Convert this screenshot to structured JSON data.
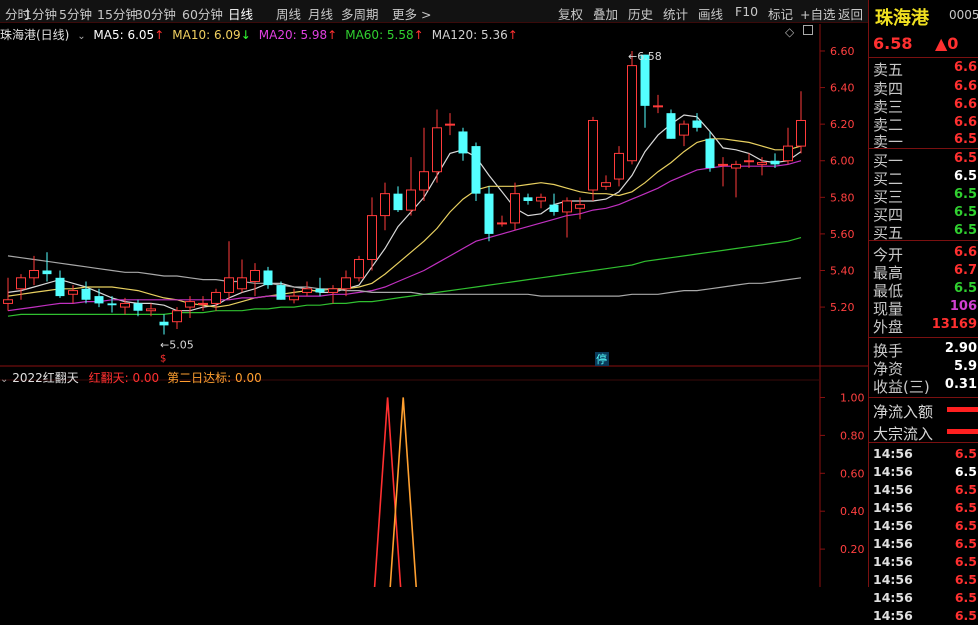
{
  "toolbar": {
    "left_items": [
      "分时",
      "1分钟",
      "5分钟",
      "15分钟",
      "30分钟",
      "60分钟",
      "日线",
      "周线",
      "月线",
      "多周期",
      "更多 >"
    ],
    "active": "日线",
    "right_items": [
      "复权",
      "叠加",
      "历史",
      "统计",
      "画线",
      "F10",
      "标记",
      "+自选",
      "返回"
    ]
  },
  "legend": {
    "title": "珠海港(日线)",
    "ma": [
      {
        "label": "MA5: 6.05",
        "arrow": "↑",
        "color": "#ffffff",
        "arrow_color": "#ff3030"
      },
      {
        "label": "MA10: 6.09",
        "arrow": "↓",
        "color": "#f0d060",
        "arrow_color": "#30ff30"
      },
      {
        "label": "MA20: 5.98",
        "arrow": "↑",
        "color": "#e040e0",
        "arrow_color": "#ff3030"
      },
      {
        "label": "MA60: 5.58",
        "arrow": "↑",
        "color": "#30d030",
        "arrow_color": "#ff3030"
      },
      {
        "label": "MA120: 5.36",
        "arrow": "↑",
        "color": "#d0d0d0",
        "arrow_color": "#ff3030"
      }
    ]
  },
  "indicator": {
    "name": "2022红翻天",
    "items": [
      {
        "label": "红翻天: 0.00",
        "color": "#ff3030"
      },
      {
        "label": "第二日达标: 0.00",
        "color": "#ffa030"
      }
    ],
    "scale": [
      "1.00",
      "0.80",
      "0.60",
      "0.40",
      "0.20"
    ]
  },
  "price_scale": [
    "6.60",
    "6.40",
    "6.20",
    "6.00",
    "5.80",
    "5.60",
    "5.40",
    "5.20"
  ],
  "annotations": {
    "high": "6.58",
    "low": "5.05",
    "stop_tag": "停"
  },
  "chart_data": {
    "type": "candlestick",
    "ylim": [
      5.02,
      6.66
    ],
    "candles": [
      [
        5.22,
        5.36,
        5.18,
        5.24
      ],
      [
        5.3,
        5.38,
        5.24,
        5.36
      ],
      [
        5.36,
        5.48,
        5.32,
        5.4
      ],
      [
        5.4,
        5.5,
        5.34,
        5.38
      ],
      [
        5.36,
        5.4,
        5.25,
        5.26
      ],
      [
        5.27,
        5.32,
        5.22,
        5.29
      ],
      [
        5.3,
        5.34,
        5.22,
        5.24
      ],
      [
        5.26,
        5.3,
        5.2,
        5.22
      ],
      [
        5.22,
        5.26,
        5.17,
        5.21
      ],
      [
        5.2,
        5.25,
        5.16,
        5.22
      ],
      [
        5.22,
        5.24,
        5.15,
        5.18
      ],
      [
        5.18,
        5.22,
        5.15,
        5.19
      ],
      [
        5.12,
        5.16,
        5.05,
        5.1
      ],
      [
        5.12,
        5.2,
        5.08,
        5.18
      ],
      [
        5.2,
        5.26,
        5.14,
        5.23
      ],
      [
        5.22,
        5.26,
        5.18,
        5.22
      ],
      [
        5.22,
        5.3,
        5.18,
        5.28
      ],
      [
        5.28,
        5.56,
        5.24,
        5.36
      ],
      [
        5.3,
        5.46,
        5.28,
        5.36
      ],
      [
        5.34,
        5.44,
        5.26,
        5.4
      ],
      [
        5.4,
        5.42,
        5.3,
        5.32
      ],
      [
        5.32,
        5.34,
        5.24,
        5.24
      ],
      [
        5.24,
        5.3,
        5.22,
        5.26
      ],
      [
        5.28,
        5.34,
        5.26,
        5.3
      ],
      [
        5.3,
        5.36,
        5.26,
        5.28
      ],
      [
        5.28,
        5.32,
        5.22,
        5.3
      ],
      [
        5.3,
        5.4,
        5.26,
        5.36
      ],
      [
        5.36,
        5.48,
        5.34,
        5.46
      ],
      [
        5.46,
        5.8,
        5.4,
        5.7
      ],
      [
        5.7,
        5.88,
        5.62,
        5.82
      ],
      [
        5.82,
        5.86,
        5.72,
        5.73
      ],
      [
        5.73,
        6.02,
        5.7,
        5.84
      ],
      [
        5.84,
        6.18,
        5.78,
        5.94
      ],
      [
        5.94,
        6.28,
        5.88,
        6.18
      ],
      [
        6.2,
        6.26,
        6.14,
        6.2
      ],
      [
        6.16,
        6.18,
        6.0,
        6.04
      ],
      [
        6.08,
        6.1,
        5.78,
        5.82
      ],
      [
        5.82,
        5.86,
        5.56,
        5.6
      ],
      [
        5.66,
        5.7,
        5.64,
        5.66
      ],
      [
        5.66,
        5.88,
        5.62,
        5.82
      ],
      [
        5.8,
        5.82,
        5.76,
        5.78
      ],
      [
        5.78,
        5.82,
        5.74,
        5.8
      ],
      [
        5.76,
        5.82,
        5.7,
        5.72
      ],
      [
        5.72,
        5.8,
        5.58,
        5.78
      ],
      [
        5.74,
        5.8,
        5.68,
        5.76
      ],
      [
        5.84,
        6.24,
        5.78,
        6.22
      ],
      [
        5.86,
        5.92,
        5.84,
        5.88
      ],
      [
        5.9,
        6.08,
        5.86,
        6.04
      ],
      [
        6.0,
        6.6,
        5.98,
        6.52
      ],
      [
        6.58,
        6.58,
        6.18,
        6.3
      ],
      [
        6.3,
        6.36,
        6.26,
        6.3
      ],
      [
        6.26,
        6.28,
        6.12,
        6.12
      ],
      [
        6.14,
        6.22,
        6.08,
        6.2
      ],
      [
        6.22,
        6.26,
        6.16,
        6.18
      ],
      [
        6.12,
        6.16,
        5.94,
        5.96
      ],
      [
        5.98,
        6.02,
        5.86,
        5.98
      ],
      [
        5.96,
        6.0,
        5.8,
        5.98
      ],
      [
        6.0,
        6.04,
        5.96,
        6.0
      ],
      [
        5.98,
        6.02,
        5.92,
        5.99
      ],
      [
        6.0,
        6.04,
        5.96,
        5.98
      ],
      [
        6.0,
        6.18,
        5.98,
        6.08
      ],
      [
        6.08,
        6.38,
        6.04,
        6.22
      ]
    ],
    "ma_lines": [
      {
        "name": "MA5",
        "color": "#d8d8d8",
        "values": [
          5.28,
          5.29,
          5.31,
          5.33,
          5.35,
          5.33,
          5.31,
          5.28,
          5.25,
          5.23,
          5.22,
          5.22,
          5.21,
          5.18,
          5.18,
          5.2,
          5.21,
          5.25,
          5.28,
          5.3,
          5.33,
          5.33,
          5.31,
          5.3,
          5.28,
          5.28,
          5.3,
          5.32,
          5.42,
          5.52,
          5.64,
          5.72,
          5.8,
          5.92,
          6.04,
          6.06,
          6.02,
          5.92,
          5.83,
          5.74,
          5.7,
          5.71,
          5.76,
          5.78,
          5.78,
          5.78,
          5.79,
          5.83,
          5.92,
          6.05,
          6.14,
          6.2,
          6.25,
          6.24,
          6.16,
          6.07,
          6.06,
          6.04,
          6.0,
          5.99,
          6.0,
          6.05
        ]
      },
      {
        "name": "MA10",
        "color": "#e8d060",
        "values": [
          5.26,
          5.27,
          5.28,
          5.29,
          5.3,
          5.3,
          5.31,
          5.31,
          5.31,
          5.3,
          5.29,
          5.27,
          5.25,
          5.24,
          5.22,
          5.21,
          5.2,
          5.21,
          5.23,
          5.25,
          5.26,
          5.27,
          5.28,
          5.29,
          5.29,
          5.3,
          5.3,
          5.31,
          5.33,
          5.38,
          5.44,
          5.5,
          5.56,
          5.63,
          5.72,
          5.79,
          5.84,
          5.86,
          5.86,
          5.86,
          5.87,
          5.88,
          5.87,
          5.85,
          5.83,
          5.82,
          5.82,
          5.81,
          5.83,
          5.88,
          5.94,
          5.99,
          6.05,
          6.1,
          6.12,
          6.12,
          6.11,
          6.1,
          6.08,
          6.06,
          6.06,
          6.08
        ]
      },
      {
        "name": "MA20",
        "color": "#c030c0",
        "values": [
          5.18,
          5.19,
          5.2,
          5.21,
          5.22,
          5.22,
          5.23,
          5.23,
          5.24,
          5.24,
          5.24,
          5.24,
          5.24,
          5.24,
          5.24,
          5.24,
          5.24,
          5.24,
          5.25,
          5.25,
          5.26,
          5.26,
          5.26,
          5.26,
          5.26,
          5.27,
          5.27,
          5.28,
          5.29,
          5.31,
          5.34,
          5.37,
          5.4,
          5.44,
          5.48,
          5.52,
          5.56,
          5.58,
          5.6,
          5.62,
          5.64,
          5.66,
          5.68,
          5.7,
          5.71,
          5.73,
          5.74,
          5.76,
          5.79,
          5.82,
          5.85,
          5.89,
          5.92,
          5.95,
          5.96,
          5.97,
          5.97,
          5.97,
          5.97,
          5.97,
          5.98,
          6.0
        ]
      },
      {
        "name": "MA60",
        "color": "#30c030",
        "values": [
          5.15,
          5.16,
          5.16,
          5.16,
          5.16,
          5.16,
          5.16,
          5.16,
          5.16,
          5.16,
          5.16,
          5.16,
          5.16,
          5.17,
          5.17,
          5.17,
          5.18,
          5.18,
          5.18,
          5.19,
          5.19,
          5.2,
          5.2,
          5.21,
          5.21,
          5.22,
          5.22,
          5.23,
          5.23,
          5.24,
          5.25,
          5.26,
          5.27,
          5.28,
          5.29,
          5.3,
          5.31,
          5.32,
          5.33,
          5.34,
          5.35,
          5.36,
          5.37,
          5.38,
          5.39,
          5.4,
          5.41,
          5.42,
          5.43,
          5.45,
          5.46,
          5.47,
          5.48,
          5.49,
          5.5,
          5.51,
          5.52,
          5.53,
          5.54,
          5.55,
          5.56,
          5.58
        ]
      },
      {
        "name": "MA120",
        "color": "#a8a8a8",
        "values": [
          5.48,
          5.47,
          5.46,
          5.45,
          5.44,
          5.43,
          5.42,
          5.41,
          5.4,
          5.39,
          5.39,
          5.38,
          5.37,
          5.37,
          5.36,
          5.35,
          5.35,
          5.34,
          5.34,
          5.33,
          5.33,
          5.32,
          5.31,
          5.31,
          5.3,
          5.3,
          5.29,
          5.29,
          5.28,
          5.28,
          5.28,
          5.28,
          5.27,
          5.27,
          5.27,
          5.27,
          5.27,
          5.27,
          5.27,
          5.27,
          5.27,
          5.26,
          5.26,
          5.26,
          5.26,
          5.26,
          5.26,
          5.26,
          5.27,
          5.27,
          5.27,
          5.28,
          5.29,
          5.29,
          5.3,
          5.31,
          5.32,
          5.33,
          5.33,
          5.34,
          5.35,
          5.36
        ]
      }
    ],
    "indicator_series": [
      {
        "name": "红翻天",
        "color": "#ff3030",
        "values": [
          0,
          0,
          0,
          0,
          0,
          0,
          0,
          0,
          0,
          0,
          0,
          0,
          0,
          0,
          0,
          0,
          0,
          0,
          0,
          0,
          0,
          0,
          0,
          0,
          0,
          0,
          0,
          0,
          0,
          0,
          0,
          0,
          0,
          0,
          0,
          0,
          0,
          0,
          0,
          0,
          0,
          0,
          0,
          0,
          0,
          0,
          0,
          0,
          0,
          0,
          0,
          0,
          0,
          0,
          0,
          0,
          0,
          0,
          0,
          0,
          0,
          0
        ]
      },
      {
        "name": "第二日达标",
        "color": "#ffa030",
        "values": [
          0,
          0,
          0,
          0,
          0,
          0,
          0,
          0,
          0,
          0,
          0,
          0,
          0,
          0,
          0,
          0,
          0,
          0,
          0,
          0,
          0,
          0,
          0,
          0,
          0,
          0,
          0,
          0,
          0,
          0,
          0,
          0,
          0,
          0,
          0,
          0,
          0,
          0,
          0,
          0,
          0,
          0,
          0,
          0,
          0,
          0,
          0,
          0,
          0,
          0,
          0,
          0,
          0,
          0,
          0,
          0,
          0,
          0,
          0,
          0,
          0,
          0
        ]
      }
    ],
    "indicator_peaks": [
      {
        "name": "红翻天",
        "index": 29.2,
        "value": 1.0,
        "color": "#ff3030"
      },
      {
        "name": "第二日达标",
        "index": 30.4,
        "value": 1.0,
        "color": "#ffa030"
      }
    ],
    "ind_ylim": [
      0,
      1.05
    ]
  },
  "right_panel": {
    "stock_name": "珠海港",
    "code": "0005",
    "price": "6.58",
    "change_arrow": "▲0",
    "quote_rows": [
      {
        "k": "卖五",
        "v": "6.6",
        "c": "#ff3030"
      },
      {
        "k": "卖四",
        "v": "6.6",
        "c": "#ff3030"
      },
      {
        "k": "卖三",
        "v": "6.6",
        "c": "#ff3030"
      },
      {
        "k": "卖二",
        "v": "6.6",
        "c": "#ff3030"
      },
      {
        "k": "卖一",
        "v": "6.5",
        "c": "#ff3030"
      },
      {
        "k": "买一",
        "v": "6.5",
        "c": "#ff3030"
      },
      {
        "k": "买二",
        "v": "6.5",
        "c": "#ffffff"
      },
      {
        "k": "买三",
        "v": "6.5",
        "c": "#30d030"
      },
      {
        "k": "买四",
        "v": "6.5",
        "c": "#30d030"
      },
      {
        "k": "买五",
        "v": "6.5",
        "c": "#30d030"
      },
      {
        "k": "今开",
        "v": "6.6",
        "c": "#ff3030"
      },
      {
        "k": "最高",
        "v": "6.7",
        "c": "#ff3030"
      },
      {
        "k": "最低",
        "v": "6.5",
        "c": "#30d030"
      },
      {
        "k": "现量",
        "v": "106",
        "c": "#d040d0"
      },
      {
        "k": "外盘",
        "v": "13169",
        "c": "#ff3030"
      },
      {
        "k": "换手",
        "v": "2.90",
        "c": "#ffffff"
      },
      {
        "k": "净资",
        "v": "5.9",
        "c": "#ffffff"
      },
      {
        "k": "收益(三)",
        "v": "0.31",
        "c": "#ffffff"
      }
    ],
    "flow": [
      {
        "label": "净流入额",
        "bar_color": "#ff2020"
      },
      {
        "label": "大宗流入",
        "bar_color": "#ff2020"
      }
    ],
    "ticks": [
      {
        "t": "14:56",
        "p": "6.5",
        "c": "#ff3030"
      },
      {
        "t": "14:56",
        "p": "6.5",
        "c": "#ffffff"
      },
      {
        "t": "14:56",
        "p": "6.5",
        "c": "#ff3030"
      },
      {
        "t": "14:56",
        "p": "6.5",
        "c": "#ff3030"
      },
      {
        "t": "14:56",
        "p": "6.5",
        "c": "#ff3030"
      },
      {
        "t": "14:56",
        "p": "6.5",
        "c": "#ff3030"
      },
      {
        "t": "14:56",
        "p": "6.5",
        "c": "#ff3030"
      },
      {
        "t": "14:56",
        "p": "6.5",
        "c": "#ff3030"
      },
      {
        "t": "14:56",
        "p": "6.5",
        "c": "#ff3030"
      },
      {
        "t": "14:56",
        "p": "6.5",
        "c": "#ff3030"
      }
    ]
  }
}
